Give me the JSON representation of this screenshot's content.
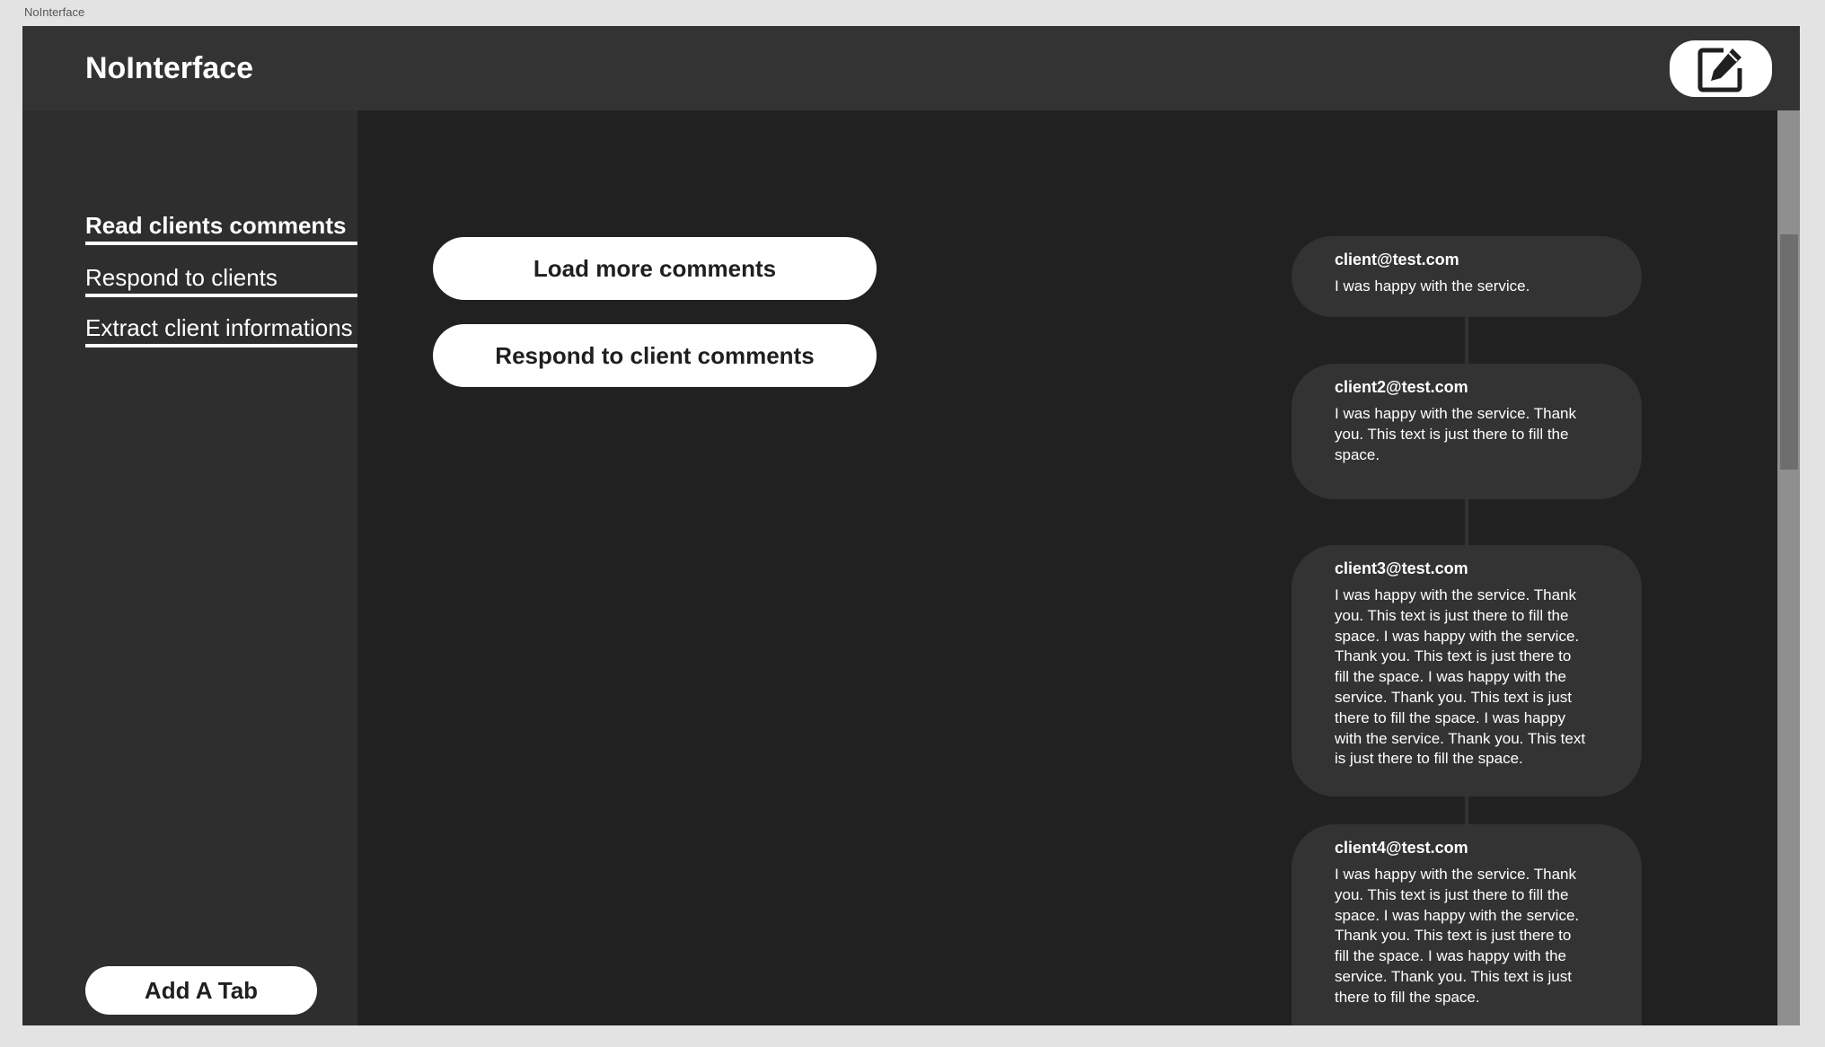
{
  "window": {
    "caption": "NoInterface"
  },
  "header": {
    "title": "NoInterface",
    "edit_icon": "edit-icon"
  },
  "sidebar": {
    "items": [
      {
        "label": "Read clients comments",
        "active": true
      },
      {
        "label": "Respond to clients",
        "active": false
      },
      {
        "label": "Extract client informations",
        "active": false
      }
    ],
    "add_tab_label": "Add A Tab"
  },
  "main": {
    "load_more_label": "Load more comments",
    "respond_label": "Respond to client comments",
    "comments": [
      {
        "email": "client@test.com",
        "text": "I was happy with the service."
      },
      {
        "email": "client2@test.com",
        "text": "I was happy with the service. Thank you. This text is just there to fill the space."
      },
      {
        "email": "client3@test.com",
        "text": "I was happy with the service. Thank you. This text is just there to fill the space. I was happy with the service. Thank you. This text is just there to fill the space. I was happy with the service. Thank you. This text is just there to fill the space. I was happy with the service. Thank you. This text is just there to fill the space."
      },
      {
        "email": "client4@test.com",
        "text": "I was happy with the service. Thank you. This text is just there to fill the space. I was happy with the service. Thank you. This text is just there to fill the space. I was happy with the service. Thank you. This text is just there to fill the space."
      }
    ]
  },
  "colors": {
    "window_bg": "#e3e3e3",
    "header_bg": "#333333",
    "sidebar_bg": "#2e2e2e",
    "main_bg": "#212121",
    "card_bg": "#333333",
    "button_bg": "#ffffff",
    "scrollbar_track": "#8f8f8f",
    "scrollbar_thumb": "#6e6e6e"
  }
}
